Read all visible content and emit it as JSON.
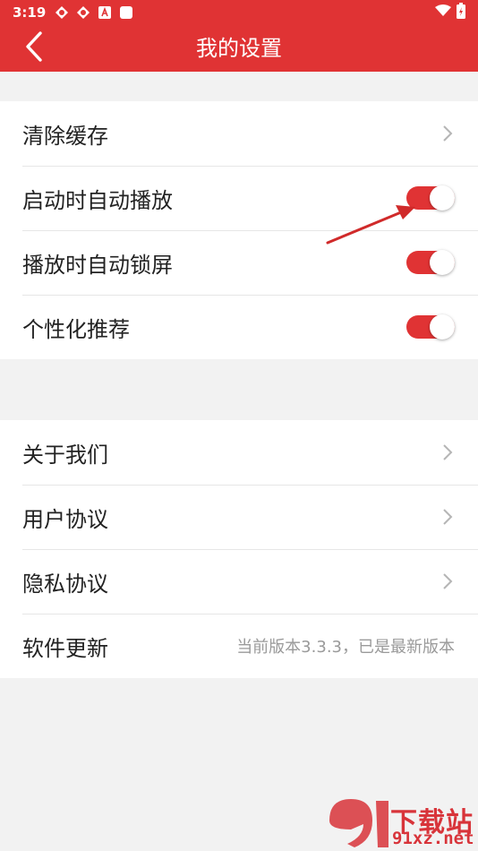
{
  "status_bar": {
    "time": "3:19",
    "left_icons": [
      "app-icon-1",
      "app-icon-2",
      "a-badge-icon",
      "square-icon"
    ],
    "right_icons": [
      "wifi-icon",
      "battery-icon"
    ]
  },
  "app_bar": {
    "title": "我的设置",
    "back_icon": "chevron-left-icon",
    "color": "#e03334"
  },
  "group1": {
    "items": [
      {
        "label": "清除缓存",
        "control": "chevron"
      },
      {
        "label": "启动时自动播放",
        "control": "toggle",
        "on": true
      },
      {
        "label": "播放时自动锁屏",
        "control": "toggle",
        "on": true
      },
      {
        "label": "个性化推荐",
        "control": "toggle",
        "on": true
      }
    ]
  },
  "group2": {
    "items": [
      {
        "label": "关于我们",
        "control": "chevron"
      },
      {
        "label": "用户协议",
        "control": "chevron"
      },
      {
        "label": "隐私协议",
        "control": "chevron"
      },
      {
        "label": "软件更新",
        "control": "text",
        "value": "当前版本3.3.3，已是最新版本"
      }
    ]
  },
  "watermark": {
    "brand": "下载站",
    "url": "91xz.net"
  },
  "colors": {
    "accent": "#e03334",
    "background": "#f2f2f2",
    "annotation_arrow": "#d02a2a"
  }
}
